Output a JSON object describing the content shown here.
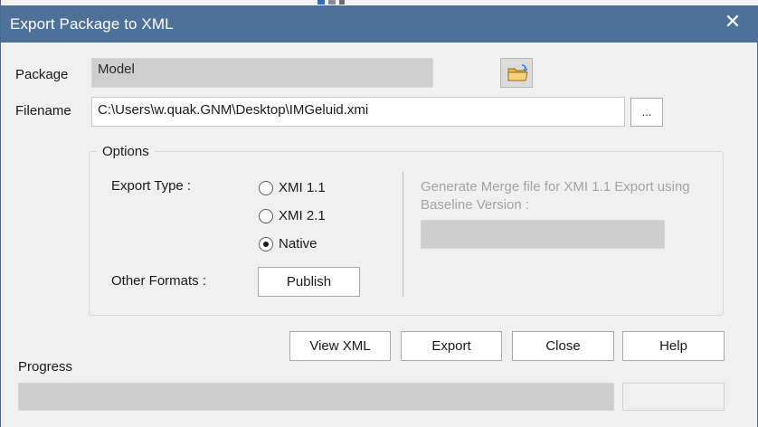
{
  "window": {
    "title": "Export Package to XML",
    "close_glyph": "✕"
  },
  "package": {
    "label": "Package",
    "value": "Model",
    "browse_icon": "folder-icon"
  },
  "filename": {
    "label": "Filename",
    "value": "C:\\Users\\w.quak.GNM\\Desktop\\IMGeluid.xmi",
    "browse_label": "..."
  },
  "options": {
    "title": "Options",
    "export_type_label": "Export Type :",
    "export_types": [
      {
        "label": "XMI 1.1",
        "selected": false
      },
      {
        "label": "XMI 2.1",
        "selected": false
      },
      {
        "label": "Native",
        "selected": true
      }
    ],
    "other_formats_label": "Other Formats :",
    "publish_label": "Publish",
    "merge_label_line1": "Generate Merge file for XMI 1.1 Export using",
    "merge_label_line2": "Baseline Version :",
    "merge_value": ""
  },
  "actions": {
    "view_xml": "View XML",
    "export": "Export",
    "close": "Close",
    "help": "Help"
  },
  "progress": {
    "label": "Progress",
    "fraction": 0,
    "status_text": ""
  },
  "colors": {
    "titlebar": "#4d7198",
    "background": "#f0f0f0",
    "disabled_text": "#a3a3a3"
  }
}
